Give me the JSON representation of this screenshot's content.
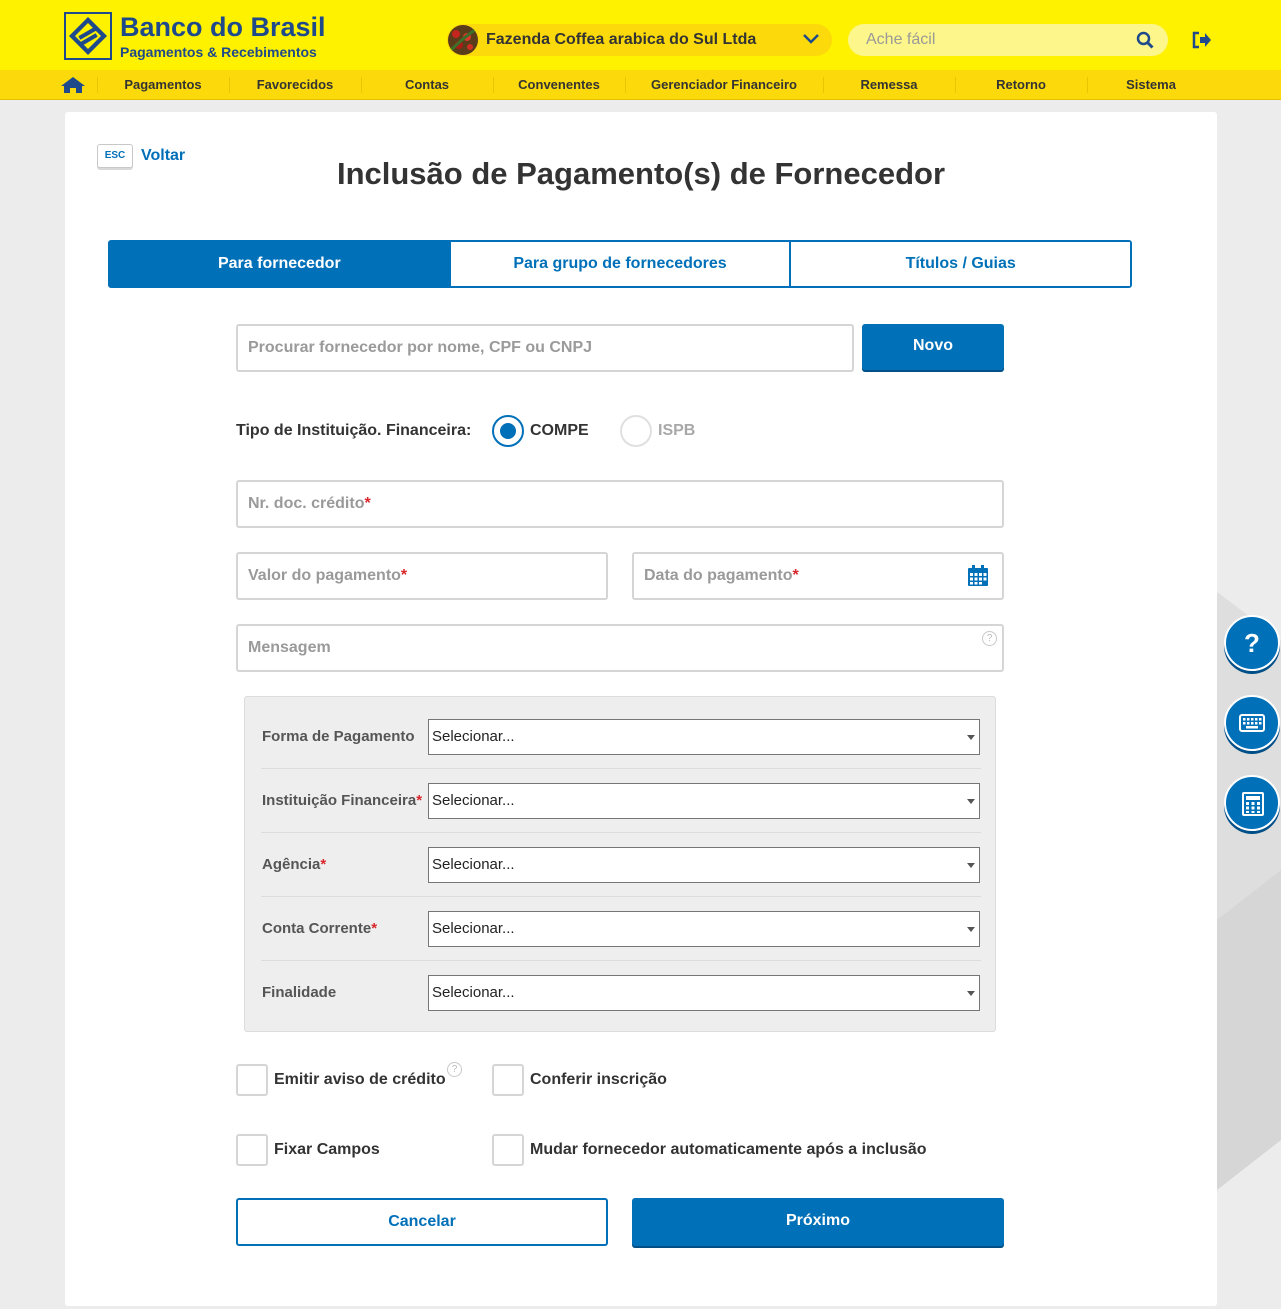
{
  "brand": {
    "title": "Banco do Brasil",
    "subtitle": "Pagamentos & Recebimentos",
    "primary_color": "#0070b9",
    "yellow": "#fef200"
  },
  "header": {
    "company_name": "Fazenda Coffea arabica do Sul Ltda",
    "search_placeholder": "Ache fácil"
  },
  "nav": {
    "items": [
      {
        "label": "Pagamentos"
      },
      {
        "label": "Favorecidos"
      },
      {
        "label": "Contas"
      },
      {
        "label": "Convenentes"
      },
      {
        "label": "Gerenciador Financeiro"
      },
      {
        "label": "Remessa"
      },
      {
        "label": "Retorno"
      },
      {
        "label": "Sistema"
      }
    ]
  },
  "page": {
    "esc_key": "ESC",
    "back_label": "Voltar",
    "title": "Inclusão de Pagamento(s) de Fornecedor"
  },
  "tabs": [
    {
      "label": "Para fornecedor",
      "active": true
    },
    {
      "label": "Para grupo de fornecedores",
      "active": false
    },
    {
      "label": "Títulos / Guias",
      "active": false
    }
  ],
  "form": {
    "supplier_search_placeholder": "Procurar fornecedor por nome, CPF ou CNPJ",
    "new_button": "Novo",
    "institution_type_label": "Tipo de Instituição. Financeira:",
    "institution_options": [
      {
        "label": "COMPE",
        "selected": true
      },
      {
        "label": "ISPB",
        "selected": false
      }
    ],
    "doc_number_label": "Nr. doc. crédito",
    "payment_value_label": "Valor do pagamento",
    "payment_date_label": "Data do pagamento",
    "message_label": "Mensagem",
    "required_mark": "*",
    "help_mark": "?"
  },
  "panel": {
    "rows": [
      {
        "label": "Forma de Pagamento",
        "required": "",
        "value": "Selecionar..."
      },
      {
        "label": "Instituição Financeira",
        "required": "*",
        "value": "Selecionar..."
      },
      {
        "label": "Agência",
        "required": "*",
        "value": "Selecionar..."
      },
      {
        "label": "Conta Corrente",
        "required": "*",
        "value": "Selecionar..."
      },
      {
        "label": "Finalidade",
        "required": "",
        "value": "Selecionar..."
      }
    ]
  },
  "checkboxes": [
    {
      "label": "Emitir aviso de crédito",
      "checked": false
    },
    {
      "label": "Conferir inscrição",
      "checked": false
    },
    {
      "label": "Fixar Campos",
      "checked": false
    },
    {
      "label": "Mudar fornecedor automaticamente após a inclusão",
      "checked": false
    }
  ],
  "actions": {
    "cancel": "Cancelar",
    "next": "Próximo"
  },
  "floating": {
    "help": "?",
    "help_icon": "question-icon",
    "keyboard_icon": "keyboard-icon",
    "calculator_icon": "calculator-icon"
  }
}
